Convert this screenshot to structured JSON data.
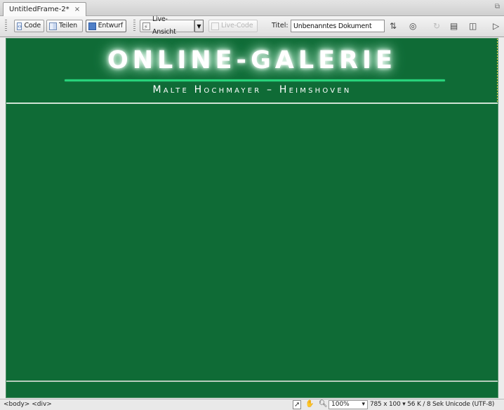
{
  "tab": {
    "label": "UntitledFrame-2*",
    "close_glyph": "×",
    "restore_glyph": "⧉"
  },
  "toolbar": {
    "code_label": "Code",
    "split_label": "Teilen",
    "design_label": "Entwurf",
    "live_view_label": "Live-Ansicht",
    "dropdown_glyph": "▼",
    "live_code_label": "Live-Code",
    "title_label": "Titel:",
    "title_value": "Unbenanntes Dokument",
    "icons": {
      "file_management": "⇅",
      "preview_browser": "◎",
      "refresh": "↻",
      "view_options": "▤",
      "visual_aids": "◫",
      "validate": "▷"
    }
  },
  "design": {
    "title": "ONLINE-GALERIE",
    "subtitle": "Malte Hochmayer – Heimshoven",
    "colors": {
      "background": "#0f6b36",
      "accent_rule": "#27d27a",
      "text": "#ffffff"
    }
  },
  "statusbar": {
    "tag_selector": "<body> <div>",
    "select_tool": "➚",
    "hand_tool": "✋",
    "zoom_tool": "🔍︎",
    "zoom_value": "100%",
    "zoom_arrow": "▾",
    "window_size": "785 x 100 ▾",
    "download": "56 K / 8 Sek",
    "encoding": "Unicode (UTF-8)"
  }
}
